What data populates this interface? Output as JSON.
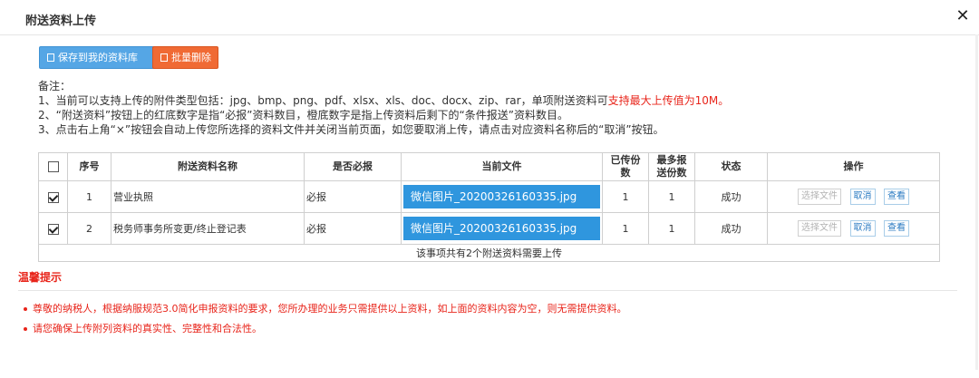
{
  "dialog": {
    "title": "附送资料上传",
    "close_label": "✕"
  },
  "toolbar": {
    "save_label": "保存到我的资料库",
    "delete_label": "批量删除"
  },
  "notes": {
    "heading": "备注：",
    "line1_prefix": "1、当前可以支持上传的附件类型包括：jpg、bmp、png、pdf、xlsx、xls、doc、docx、zip、rar，单项附送资料可",
    "line1_red": "支持最大上传值为10M。",
    "line2": "2、“附送资料”按钮上的红底数字是指“必报”资料数目，橙底数字是指上传资料后剩下的“条件报送”资料数目。",
    "line3": "3、点击右上角“×”按钮会自动上传您所选择的资料文件并关闭当前页面，如您要取消上传，请点击对应资料名称后的“取消”按钮。"
  },
  "table": {
    "headers": {
      "seq": "序号",
      "name": "附送资料名称",
      "required": "是否必报",
      "file": "当前文件",
      "uploaded_a": "已传份",
      "uploaded_b": "数",
      "max_a": "最多报",
      "max_b": "送份数",
      "status": "状态",
      "ops": "操作"
    },
    "rows": [
      {
        "checked": true,
        "seq": "1",
        "name": "营业执照",
        "required": "必报",
        "file": "微信图片_20200326160335.jpg",
        "uploaded": "1",
        "max": "1",
        "status": "成功"
      },
      {
        "checked": true,
        "seq": "2",
        "name": "税务师事务所变更/终止登记表",
        "required": "必报",
        "file": "微信图片_20200326160335.jpg",
        "uploaded": "1",
        "max": "1",
        "status": "成功"
      }
    ],
    "ops": {
      "choose": "选择文件",
      "cancel": "取消",
      "view": "查看"
    },
    "footer": "该事项共有2个附送资料需要上传"
  },
  "tips": {
    "title": "温馨提示",
    "items": [
      "尊敬的纳税人，根据纳服规范3.0简化申报资料的要求，您所办理的业务只需提供以上资料，如上面的资料内容为空，则无需提供资料。",
      "请您确保上传附列资料的真实性、完整性和合法性。"
    ]
  },
  "colors": {
    "primary": "#55a6e5",
    "danger": "#f06a34",
    "highlight": "#2f96de",
    "alert": "#e8241a"
  }
}
